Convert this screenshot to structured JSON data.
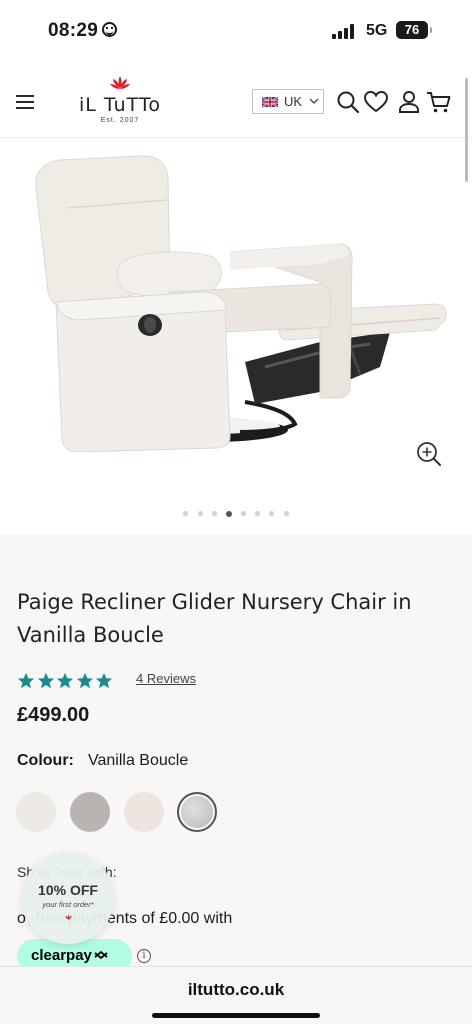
{
  "status_bar": {
    "time": "08:29",
    "network": "5G",
    "battery": "76"
  },
  "header": {
    "logo_name": "iL TuTTo",
    "logo_est": "Est. 2007",
    "country": "UK",
    "icons": [
      "menu-icon",
      "search-icon",
      "heart-icon",
      "account-icon",
      "basket-icon"
    ]
  },
  "gallery": {
    "slide_count": 8,
    "active_slide": 4
  },
  "product": {
    "title": "Paige Recliner Glider Nursery Chair in Vanilla Boucle",
    "rating": 5,
    "reviews_label": "4 Reviews",
    "price": "£499.00",
    "colour_label": "Colour:",
    "colour_value": "Vanilla Boucle",
    "swatches": [
      "#ece8e4",
      "#b9b4b1",
      "#efe5e0",
      "#c9c9c9"
    ],
    "shop_text": "Sh      ay later with:",
    "pay_text": "o      -free payments of £0.00 with"
  },
  "clearpay": {
    "label": "clearpay",
    "info": "i"
  },
  "offer": {
    "title": "10% OFF",
    "subtitle": "your first order*"
  },
  "browser": {
    "url": "iltutto.co.uk"
  },
  "colors": {
    "accent_teal": "#1a8c8c",
    "brand_red": "#d6202a",
    "clearpay_mint": "#b2fce4",
    "info_bg": "#f8f7f5"
  }
}
